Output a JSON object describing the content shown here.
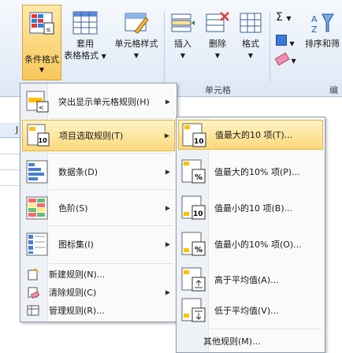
{
  "ribbon": {
    "conditional_format": "条件格式",
    "table_format_line1": "套用",
    "table_format_line2": "表格格式",
    "cell_styles": "单元格样式",
    "insert": "插入",
    "delete": "删除",
    "format": "格式",
    "sort_filter": "排序和筛",
    "group_cells": "单元格",
    "group_edit": "编",
    "sigma": "Σ",
    "left_cut": "J"
  },
  "menu": {
    "items": [
      {
        "label": "突出显示单元格规则(H)",
        "icon": "highlight-rules-icon"
      },
      {
        "label": "项目选取规则(T)",
        "icon": "top-bottom-rules-icon"
      },
      {
        "label": "数据条(D)",
        "icon": "data-bars-icon"
      },
      {
        "label": "色阶(S)",
        "icon": "color-scales-icon"
      },
      {
        "label": "图标集(I)",
        "icon": "icon-sets-icon"
      }
    ],
    "small_items": [
      {
        "label": "新建规则(N)...",
        "icon": "new-rule-icon"
      },
      {
        "label": "清除规则(C)",
        "icon": "clear-rules-icon"
      },
      {
        "label": "管理规则(R)...",
        "icon": "manage-rules-icon"
      }
    ]
  },
  "submenu": {
    "items": [
      {
        "label": "值最大的10 项(T)...",
        "icon_text": "10"
      },
      {
        "label": "值最大的10% 项(P)...",
        "icon_text": "%"
      },
      {
        "label": "值最小的10 项(B)...",
        "icon_text": "10"
      },
      {
        "label": "值最小的10% 项(O)...",
        "icon_text": "%"
      },
      {
        "label": "高于平均值(A)...",
        "icon_text": ""
      },
      {
        "label": "低于平均值(V)...",
        "icon_text": ""
      }
    ],
    "more": "其他规则(M)..."
  },
  "colors": {
    "highlight": "#fbd97a",
    "accent": "#1f5fb4"
  }
}
